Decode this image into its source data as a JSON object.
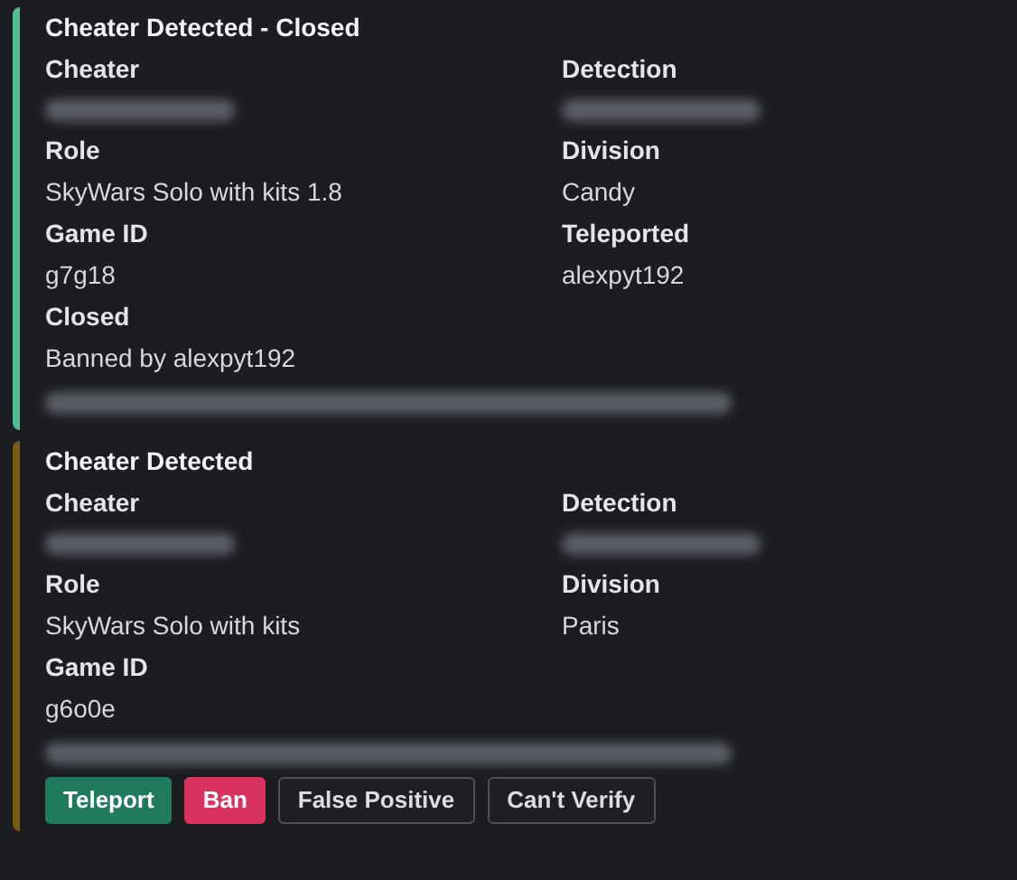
{
  "embeds": [
    {
      "color": "#4fbf8f",
      "title": "Cheater Detected - Closed",
      "rows": [
        [
          {
            "name": "Cheater",
            "redacted": true
          },
          {
            "name": "Detection",
            "redacted": true
          }
        ],
        [
          {
            "name": "Role",
            "value": "SkyWars Solo with kits 1.8"
          },
          {
            "name": "Division",
            "value": "Candy"
          }
        ],
        [
          {
            "name": "Game ID",
            "value": "g7g18"
          },
          {
            "name": "Teleported",
            "value": "alexpyt192"
          }
        ],
        [
          {
            "name": "Closed",
            "value": "Banned by alexpyt192"
          }
        ]
      ],
      "footer_redacted": true
    },
    {
      "color": "#7a5a12",
      "title": "Cheater Detected",
      "rows": [
        [
          {
            "name": "Cheater",
            "redacted": true
          },
          {
            "name": "Detection",
            "redacted": true
          }
        ],
        [
          {
            "name": "Role",
            "value": "SkyWars Solo with kits"
          },
          {
            "name": "Division",
            "value": "Paris"
          }
        ],
        [
          {
            "name": "Game ID",
            "value": "g6o0e"
          }
        ]
      ],
      "footer_redacted": true,
      "buttons": [
        {
          "label": "Teleport",
          "kind": "success"
        },
        {
          "label": "Ban",
          "kind": "danger"
        },
        {
          "label": "False Positive",
          "kind": "secondary"
        },
        {
          "label": "Can't Verify",
          "kind": "secondary"
        }
      ]
    }
  ]
}
